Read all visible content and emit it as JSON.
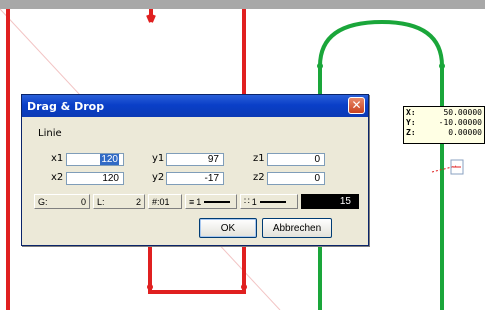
{
  "colors": {
    "red_path": "#e02020",
    "green_path": "#1aa63a",
    "guide_line": "#f2c4c4",
    "dialog_bg": "#ece9d8",
    "titlebar": "#0a3fc8"
  },
  "readout": {
    "x_label": "X:",
    "x_value": "50.00000",
    "y_label": "Y:",
    "y_value": "-10.00000",
    "z_label": "Z:",
    "z_value": "0.00000"
  },
  "dialog": {
    "title": "Drag & Drop",
    "close_icon": "close-icon",
    "group_label": "Linie",
    "fields": {
      "x1_label": "x1",
      "x1_value": "120",
      "y1_label": "y1",
      "y1_value": "97",
      "z1_label": "z1",
      "z1_value": "0",
      "x2_label": "x2",
      "x2_value": "120",
      "y2_label": "y2",
      "y2_value": "-17",
      "z2_label": "z2",
      "z2_value": "0"
    },
    "toolbar": {
      "g_label": "G:",
      "g_value": "0",
      "l_label": "L:",
      "l_value": "2",
      "h_label": "#:01",
      "w1_label": "1",
      "w2_label": "1",
      "color_value": "15"
    },
    "ok_label": "OK",
    "cancel_label": "Abbrechen"
  }
}
